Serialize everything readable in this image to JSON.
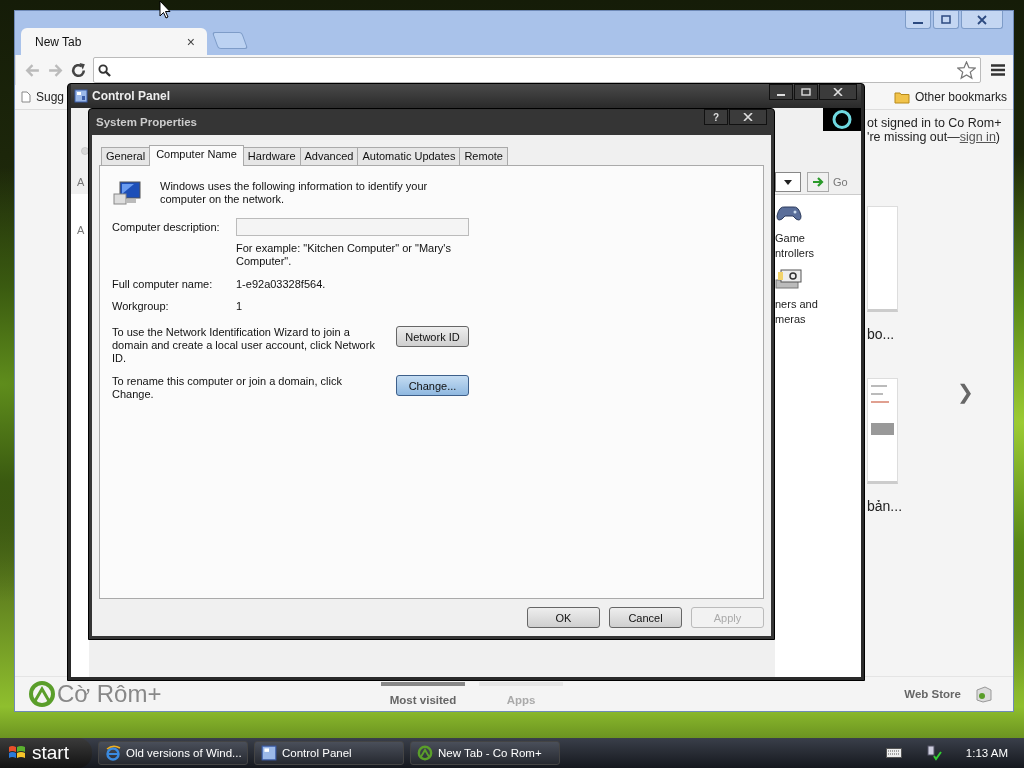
{
  "browser": {
    "tabs": [
      {
        "label": "New Tab",
        "close": "×",
        "selected": true
      }
    ],
    "bookmarks": [
      "Sugg"
    ],
    "other_bookmarks": "Other bookmarks",
    "signin": {
      "text": "ot signed in to Co Rom+",
      "missing": "'re missing out—",
      "link": "sign in",
      "close_paren": ")"
    },
    "thumbnails": [
      {
        "caption": "bo...",
        "kind": "blank"
      },
      {
        "caption": "bản...",
        "kind": "page"
      }
    ],
    "next": "❯",
    "logo": "Cờ Rôm+",
    "footer_tabs": [
      {
        "label": "Most visited",
        "selected": true
      },
      {
        "label": "Apps",
        "selected": false
      }
    ],
    "web_store": "Web Store"
  },
  "control_panel": {
    "title": "Control Panel",
    "left_labels": [
      "A",
      "A"
    ],
    "go": "Go",
    "items": [
      {
        "lines": [
          "Game",
          "ntrollers"
        ],
        "kind": "gamepad"
      },
      {
        "lines": [
          "ners and",
          "meras"
        ],
        "kind": "camera"
      }
    ]
  },
  "dialog": {
    "title": "System Properties",
    "help": "?",
    "tabs": [
      {
        "label": "General",
        "selected": false
      },
      {
        "label": "Computer Name",
        "selected": true
      },
      {
        "label": "Hardware",
        "selected": false
      },
      {
        "label": "Advanced",
        "selected": false
      },
      {
        "label": "Automatic Updates",
        "selected": false
      },
      {
        "label": "Remote",
        "selected": false
      }
    ],
    "intro": "Windows uses the following information to identify your computer on the network.",
    "description_label": "Computer description:",
    "example": "For example: \"Kitchen Computer\" or \"Mary's Computer\".",
    "full_name_label": "Full computer name:",
    "full_name": "1-e92a03328f564.",
    "workgroup_label": "Workgroup:",
    "workgroup": "1",
    "actions": [
      {
        "text": "To use the Network Identification Wizard to join a domain and create a local user account, click Network ID.",
        "button": "Network ID",
        "default": false
      },
      {
        "text": "To rename this computer or join a domain, click Change.",
        "button": "Change...",
        "default": true
      }
    ],
    "buttons": [
      {
        "label": "OK",
        "disabled": false
      },
      {
        "label": "Cancel",
        "disabled": false
      },
      {
        "label": "Apply",
        "disabled": true
      }
    ]
  },
  "taskbar": {
    "start": "start",
    "tasks": [
      {
        "label": "Old versions of Wind...",
        "kind": "ie"
      },
      {
        "label": "Control Panel",
        "kind": "cp"
      },
      {
        "label": "New Tab - Co Rom+",
        "kind": "chrome"
      }
    ],
    "clock": "1:13 AM"
  }
}
